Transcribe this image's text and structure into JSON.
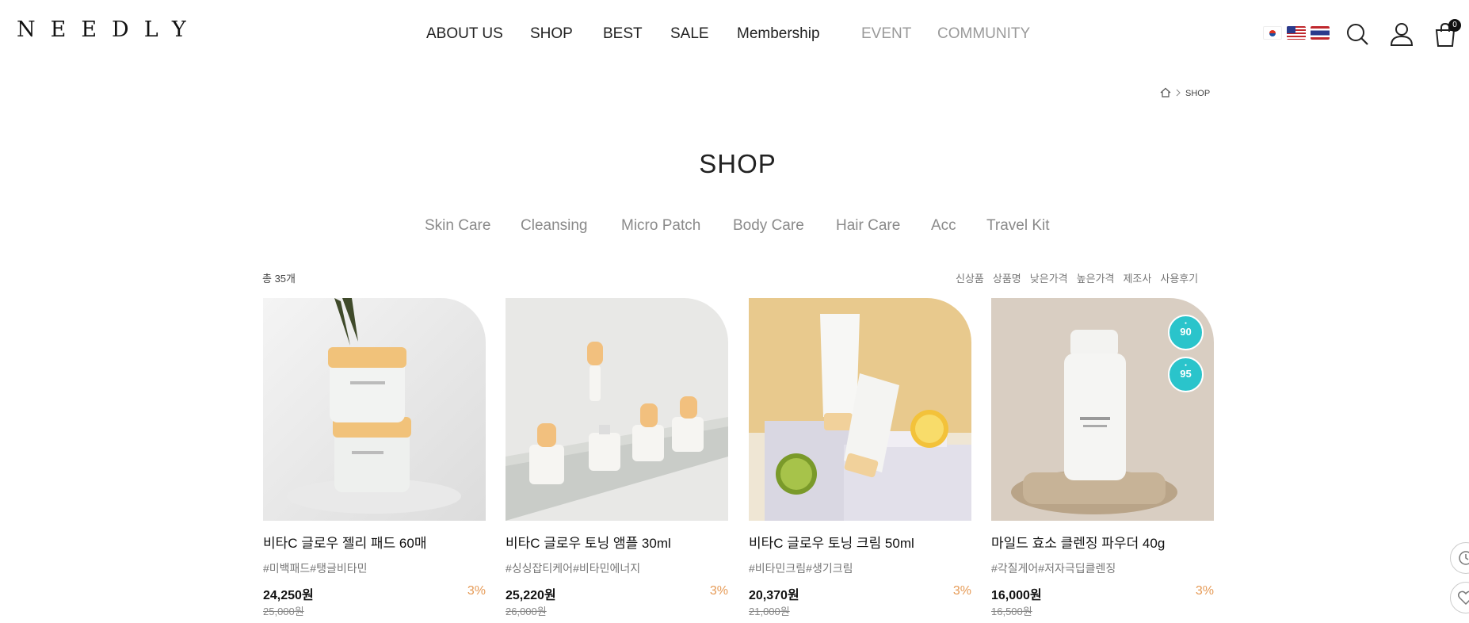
{
  "header": {
    "logo": "NEEDLY",
    "nav": [
      "ABOUT US",
      "SHOP",
      "BEST",
      "SALE",
      "Membership",
      "EVENT",
      "COMMUNITY"
    ],
    "flags": [
      "korea-flag",
      "usa-flag",
      "thailand-flag"
    ],
    "cart_count": "0"
  },
  "breadcrumb": {
    "current": "SHOP"
  },
  "page": {
    "title": "SHOP",
    "categories": [
      "Skin Care",
      "Cleansing",
      "Micro Patch",
      "Body Care",
      "Hair Care",
      "Acc",
      "Travel Kit"
    ],
    "total": "총 35개",
    "sorts": [
      "신상품",
      "상품명",
      "낮은가격",
      "높은가격",
      "제조사",
      "사용후기"
    ]
  },
  "products": [
    {
      "name": "비타C 글로우 젤리 패드 60매",
      "tags": "#미백패드#탱글비타민",
      "price": "24,250원",
      "discount": "3%",
      "original": "25,000원"
    },
    {
      "name": "비타C 글로우 토닝 앰플 30ml",
      "tags": "#싱싱잡티케어#비타민에너지",
      "price": "25,220원",
      "discount": "3%",
      "original": "26,000원"
    },
    {
      "name": "비타C 글로우 토닝 크림 50ml",
      "tags": "#비타민크림#생기크림",
      "price": "20,370원",
      "discount": "3%",
      "original": "21,000원"
    },
    {
      "name": "마일드 효소 클렌징 파우더 40g",
      "tags": "#각질게어#저자극딥클렌징",
      "price": "16,000원",
      "discount": "3%",
      "original": "16,500원",
      "badges": [
        "90",
        "95"
      ]
    }
  ],
  "colors": {
    "accent_discount": "#e69b57",
    "badge": "#2ac4cb"
  }
}
